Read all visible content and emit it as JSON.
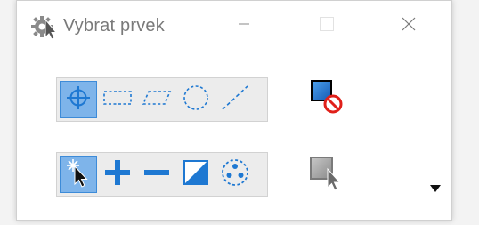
{
  "window": {
    "title": "Vybrat prvek"
  },
  "icons": {
    "app": "settings-cursor-icon",
    "minimize": "minimize-icon",
    "maximize": "maximize-icon",
    "close": "close-icon"
  },
  "colors": {
    "accent": "#1e78d2",
    "active_bg": "#7eb4ea",
    "prohibit": "#e0201a"
  },
  "selection_methods": [
    {
      "icon": "crosshair-icon",
      "active": true
    },
    {
      "icon": "rectangle-select-icon",
      "active": false
    },
    {
      "icon": "shape-select-icon",
      "active": false
    },
    {
      "icon": "circle-select-icon",
      "active": false
    },
    {
      "icon": "line-select-icon",
      "active": false
    }
  ],
  "selection_modes": [
    {
      "icon": "new-selection-icon",
      "active": true
    },
    {
      "icon": "add-icon",
      "active": false
    },
    {
      "icon": "subtract-icon",
      "active": false
    },
    {
      "icon": "invert-icon",
      "active": false
    },
    {
      "icon": "intersect-icon",
      "active": false
    }
  ],
  "actions": [
    {
      "icon": "deselect-all-icon"
    },
    {
      "icon": "select-all-icon"
    }
  ]
}
